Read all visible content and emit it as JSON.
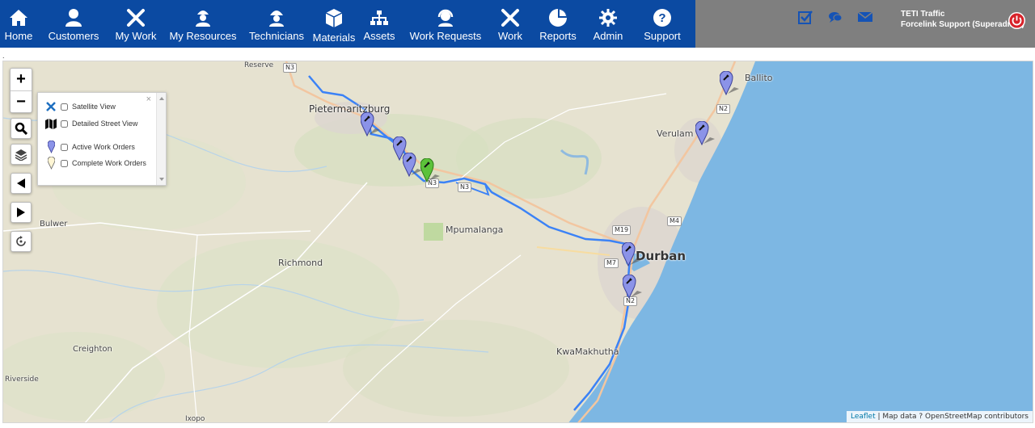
{
  "nav": [
    {
      "label": "Home",
      "icon": "home-icon"
    },
    {
      "label": "Customers",
      "icon": "customers-icon"
    },
    {
      "label": "My Work",
      "icon": "tools-icon"
    },
    {
      "label": "My Resources",
      "icon": "worker-icon"
    },
    {
      "label": "Technicians",
      "icon": "technician-icon"
    },
    {
      "label": "Materials",
      "icon": "box-icon"
    },
    {
      "label": "Assets",
      "icon": "hierarchy-icon"
    },
    {
      "label": "Work Requests",
      "icon": "headset-icon"
    },
    {
      "label": "Work",
      "icon": "tools-icon"
    },
    {
      "label": "Reports",
      "icon": "pie-chart-icon"
    },
    {
      "label": "Admin",
      "icon": "gear-icon"
    },
    {
      "label": "Support",
      "icon": "help-icon"
    }
  ],
  "utility_icons": [
    "tasks-icon",
    "chat-icon",
    "mail-icon"
  ],
  "user": {
    "org": "TETI Traffic",
    "name": "Forcelink Support (Superadmin)"
  },
  "page_marker": ".",
  "map": {
    "zoom_in": "+",
    "zoom_out": "−",
    "layers": {
      "satellite": "Satellite View",
      "street": "Detailed Street View",
      "active": "Active Work Orders",
      "complete": "Complete Work Orders",
      "close": "×"
    },
    "places": {
      "reserve": "Reserve",
      "pmb": "Pietermaritzburg",
      "ballito": "Ballito",
      "verulam": "Verulam",
      "bulwer": "Bulwer",
      "mpumalanga": "Mpumalanga",
      "richmond": "Richmond",
      "durban": "Durban",
      "creighton": "Creighton",
      "kwamakhutha": "KwaMakhutha",
      "riverside": "Riverside",
      "ixopo": "Ixopo"
    },
    "roads": {
      "n3a": "N3",
      "n3b": "N3",
      "n3c": "N3",
      "n2a": "N2",
      "n2b": "N2",
      "m4": "M4",
      "m19": "M19",
      "m7": "M7"
    },
    "attribution": {
      "leaflet": "Leaflet",
      "sep": " | ",
      "text": "Map data ? OpenStreetMap contributors"
    },
    "colors": {
      "route": "#3b82f6",
      "pin_active": "#8b93e8",
      "pin_selected": "#5cc23a",
      "sea": "#7db7e3"
    }
  }
}
